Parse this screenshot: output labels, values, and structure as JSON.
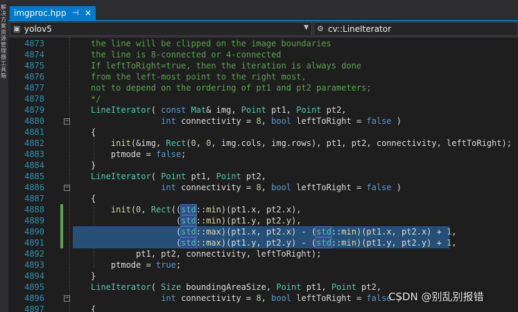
{
  "side_panel": {
    "text": "解决方案资源管理器 工具箱"
  },
  "tab": {
    "title": "imgproc.hpp",
    "pin_glyph": "⊣",
    "close_glyph": "✕"
  },
  "nav": {
    "project": "yolov5",
    "scope": "cv::LineIterator",
    "project_icon": "file-icon",
    "scope_icon": "class-icon"
  },
  "lines": [
    {
      "num": "4873",
      "parts": [
        [
          "c",
          "the line will be clipped on the image boundaries"
        ]
      ]
    },
    {
      "num": "4874",
      "parts": [
        [
          "c",
          "the line is 8-connected or 4-connected"
        ]
      ]
    },
    {
      "num": "4875",
      "parts": [
        [
          "c",
          "If leftToRight=true, then the iteration is always done"
        ]
      ]
    },
    {
      "num": "4876",
      "parts": [
        [
          "c",
          "from the left-most point to the right most,"
        ]
      ]
    },
    {
      "num": "4877",
      "parts": [
        [
          "c",
          "not to depend on the ordering of pt1 and pt2 parameters;"
        ]
      ]
    },
    {
      "num": "4878",
      "parts": [
        [
          "c",
          "*/"
        ]
      ]
    },
    {
      "num": "4879",
      "parts": [
        [
          "ty",
          "LineIterator"
        ],
        [
          "p",
          "( "
        ],
        [
          "k",
          "const"
        ],
        [
          "p",
          " "
        ],
        [
          "ty",
          "Mat"
        ],
        [
          "p",
          "& img, "
        ],
        [
          "ty",
          "Point"
        ],
        [
          "p",
          " pt1, "
        ],
        [
          "ty",
          "Point"
        ],
        [
          "p",
          " pt2,"
        ]
      ]
    },
    {
      "num": "4880",
      "fold": true,
      "parts": [
        [
          "p",
          "              "
        ],
        [
          "k",
          "int"
        ],
        [
          "p",
          " connectivity = "
        ],
        [
          "n",
          "8"
        ],
        [
          "p",
          ", "
        ],
        [
          "k",
          "bool"
        ],
        [
          "p",
          " leftToRight = "
        ],
        [
          "k",
          "false"
        ],
        [
          "p",
          " )"
        ]
      ]
    },
    {
      "num": "4881",
      "parts": [
        [
          "p",
          "{"
        ]
      ]
    },
    {
      "num": "4882",
      "parts": [
        [
          "p",
          "    "
        ],
        [
          "f",
          "init"
        ],
        [
          "p",
          "(&img, "
        ],
        [
          "ty",
          "Rect"
        ],
        [
          "p",
          "("
        ],
        [
          "n",
          "0"
        ],
        [
          "p",
          ", "
        ],
        [
          "n",
          "0"
        ],
        [
          "p",
          ", img.cols, img.rows), pt1, pt2, connectivity, leftToRight);"
        ]
      ]
    },
    {
      "num": "4883",
      "parts": [
        [
          "p",
          "    ptmode = "
        ],
        [
          "k",
          "false"
        ],
        [
          "p",
          ";"
        ]
      ]
    },
    {
      "num": "4884",
      "parts": [
        [
          "p",
          "}"
        ]
      ]
    },
    {
      "num": "4885",
      "parts": [
        [
          "ty",
          "LineIterator"
        ],
        [
          "p",
          "( "
        ],
        [
          "ty",
          "Point"
        ],
        [
          "p",
          " pt1, "
        ],
        [
          "ty",
          "Point"
        ],
        [
          "p",
          " pt2,"
        ]
      ]
    },
    {
      "num": "4886",
      "fold": true,
      "parts": [
        [
          "p",
          "              "
        ],
        [
          "k",
          "int"
        ],
        [
          "p",
          " connectivity = "
        ],
        [
          "n",
          "8"
        ],
        [
          "p",
          ", "
        ],
        [
          "k",
          "bool"
        ],
        [
          "p",
          " leftToRight = "
        ],
        [
          "k",
          "false"
        ],
        [
          "p",
          " )"
        ]
      ]
    },
    {
      "num": "4887",
      "parts": [
        [
          "p",
          "{"
        ]
      ]
    },
    {
      "num": "4888",
      "changed": true,
      "parts": [
        [
          "p",
          "    "
        ],
        [
          "f",
          "init"
        ],
        [
          "p",
          "("
        ],
        [
          "n",
          "0"
        ],
        [
          "p",
          ", "
        ],
        [
          "ty",
          "Rect"
        ],
        [
          "p",
          "(("
        ],
        [
          "ns",
          "std"
        ],
        [
          "p",
          "::"
        ],
        [
          "f",
          "min"
        ],
        [
          "p",
          ")(pt1.x, pt2.x),"
        ]
      ]
    },
    {
      "num": "4889",
      "changed": true,
      "parts": [
        [
          "p",
          "                 ("
        ],
        [
          "ns",
          "std"
        ],
        [
          "p",
          "::"
        ],
        [
          "f",
          "min"
        ],
        [
          "p",
          ")(pt1.y, pt2.y),"
        ]
      ]
    },
    {
      "num": "4890",
      "changed": true,
      "selected": true,
      "parts": [
        [
          "p",
          "                 ("
        ],
        [
          "ns",
          "std"
        ],
        [
          "p",
          "::"
        ],
        [
          "f",
          "max"
        ],
        [
          "p",
          ")(pt1.x, pt2.x) - ("
        ],
        [
          "ns",
          "std"
        ],
        [
          "p",
          "::"
        ],
        [
          "f",
          "min"
        ],
        [
          "p",
          ")(pt1.x, pt2.x) + "
        ],
        [
          "n",
          "1"
        ],
        [
          "p",
          ","
        ]
      ]
    },
    {
      "num": "4891",
      "changed": true,
      "selected": true,
      "parts": [
        [
          "p",
          "                 ("
        ],
        [
          "ns",
          "std"
        ],
        [
          "p",
          "::"
        ],
        [
          "f",
          "max"
        ],
        [
          "p",
          ")(pt1.y, pt2.y) - ("
        ],
        [
          "ns",
          "std"
        ],
        [
          "p",
          "::"
        ],
        [
          "f",
          "min"
        ],
        [
          "p",
          ")(pt1.y, pt2.y) + "
        ],
        [
          "n",
          "1"
        ],
        [
          "p",
          ","
        ]
      ]
    },
    {
      "num": "4892",
      "parts": [
        [
          "p",
          "         pt1, pt2, connectivity, leftToRight);"
        ]
      ]
    },
    {
      "num": "4893",
      "parts": [
        [
          "p",
          "    ptmode = "
        ],
        [
          "k",
          "true"
        ],
        [
          "p",
          ";"
        ]
      ]
    },
    {
      "num": "4894",
      "parts": [
        [
          "p",
          "}"
        ]
      ]
    },
    {
      "num": "4895",
      "parts": [
        [
          "ty",
          "LineIterator"
        ],
        [
          "p",
          "( "
        ],
        [
          "ty",
          "Size"
        ],
        [
          "p",
          " boundingAreaSize, "
        ],
        [
          "ty",
          "Point"
        ],
        [
          "p",
          " pt1, "
        ],
        [
          "ty",
          "Point"
        ],
        [
          "p",
          " pt2,"
        ]
      ]
    },
    {
      "num": "4896",
      "fold": true,
      "parts": [
        [
          "p",
          "              "
        ],
        [
          "k",
          "int"
        ],
        [
          "p",
          " connectivity = "
        ],
        [
          "n",
          "8"
        ],
        [
          "p",
          ", "
        ],
        [
          "k",
          "bool"
        ],
        [
          "p",
          " leftToRight = "
        ],
        [
          "k",
          "false"
        ],
        [
          "p",
          " )"
        ]
      ]
    },
    {
      "num": "4897",
      "parts": [
        [
          "p",
          "{"
        ]
      ]
    }
  ],
  "watermark": "CSDN @别乱别报错",
  "colors": {
    "accent": "#007acc",
    "selection": "#264f78",
    "comment": "#57a64a",
    "keyword": "#569cd6",
    "type": "#4ec9b0",
    "number": "#b5cea8",
    "function": "#dcdcaa",
    "line_number": "#2b91af"
  }
}
